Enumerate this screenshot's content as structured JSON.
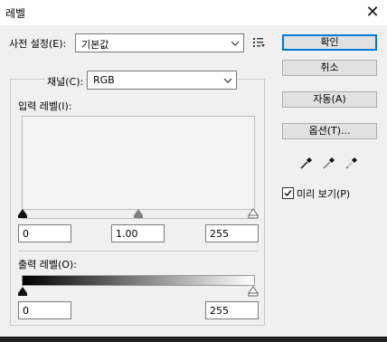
{
  "window": {
    "title": "레벨",
    "close_glyph": "✕"
  },
  "preset": {
    "label": "사전 설정(E):",
    "value": "기본값"
  },
  "channel": {
    "label": "채널(C):",
    "value": "RGB"
  },
  "input_levels": {
    "label": "입력 레벨(I):",
    "black": "0",
    "gamma": "1.00",
    "white": "255"
  },
  "output_levels": {
    "label": "출력 레벨(O):",
    "black": "0",
    "white": "255"
  },
  "buttons": {
    "ok": "확인",
    "cancel": "취소",
    "auto": "자동(A)",
    "options": "옵션(T)..."
  },
  "preview": {
    "label": "미리 보기(P)",
    "checked": true
  },
  "colors": {
    "accent": "#0078d7",
    "background": "#f0f0f0"
  },
  "icons": [
    "preset-options-icon",
    "black-eyedropper-icon",
    "gray-eyedropper-icon",
    "white-eyedropper-icon"
  ]
}
